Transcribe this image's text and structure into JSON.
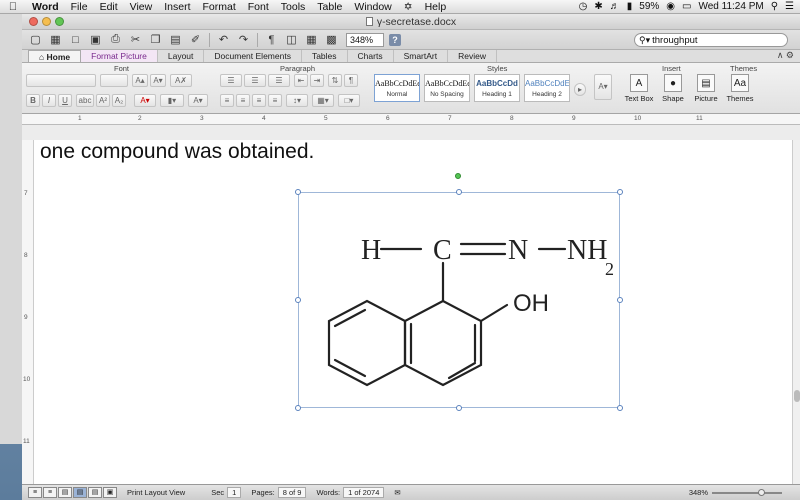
{
  "menubar": {
    "app_name": "Word",
    "items": [
      "File",
      "Edit",
      "View",
      "Insert",
      "Format",
      "Font",
      "Tools",
      "Table",
      "Window",
      "Help"
    ],
    "battery": "59%",
    "clock": "Wed 11:24 PM"
  },
  "window": {
    "title": "γ-secretase.docx",
    "zoom": "348%",
    "search_value": "throughput"
  },
  "tabs": [
    "Home",
    "Format Picture",
    "Layout",
    "Document Elements",
    "Tables",
    "Charts",
    "SmartArt",
    "Review"
  ],
  "ribbon": {
    "group_font": "Font",
    "group_paragraph": "Paragraph",
    "group_styles": "Styles",
    "group_insert": "Insert",
    "group_themes": "Themes",
    "styles": [
      {
        "preview": "AaBbCcDdEe",
        "name": "Normal"
      },
      {
        "preview": "AaBbCcDdEe",
        "name": "No Spacing"
      },
      {
        "preview": "AaBbCcDd",
        "name": "Heading 1"
      },
      {
        "preview": "AaBbCcDdEe",
        "name": "Heading 2"
      }
    ],
    "insert_buttons": [
      "Text Box",
      "Shape",
      "Picture"
    ],
    "themes_button": "Themes"
  },
  "ruler_numbers": [
    "1",
    "2",
    "3",
    "4",
    "5",
    "6",
    "7",
    "8",
    "9",
    "10",
    "11"
  ],
  "vruler_numbers": [
    "7",
    "8",
    "9",
    "10",
    "11"
  ],
  "document": {
    "text_line": "one compound was obtained."
  },
  "molecule": {
    "h": "H",
    "c": "C",
    "n1": "N",
    "nh": "NH",
    "sub2": "2",
    "oh": "OH"
  },
  "status": {
    "view_label": "Print Layout View",
    "sec_label": "Sec",
    "sec_value": "1",
    "pages_label": "Pages:",
    "pages_value": "8 of 9",
    "words_label": "Words:",
    "words_value": "1 of 2074",
    "zoom": "348%"
  }
}
